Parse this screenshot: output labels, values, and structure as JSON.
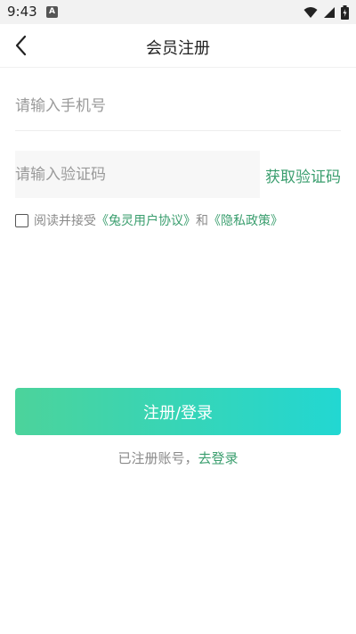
{
  "status_bar": {
    "time": "9:43",
    "notification_badge": "A",
    "icons": [
      "wifi-icon",
      "signal-icon",
      "battery-icon"
    ]
  },
  "header": {
    "title": "会员注册",
    "back_icon": "chevron-left-icon"
  },
  "form": {
    "phone_placeholder": "请输入手机号",
    "phone_value": "",
    "code_placeholder": "请输入验证码",
    "code_value": "",
    "get_code_label": "获取验证码"
  },
  "agreement": {
    "checked": false,
    "prefix": "阅读并接受",
    "user_agreement": "《兔灵用户协议》",
    "conjunction": "和",
    "privacy_policy": "《隐私政策》"
  },
  "actions": {
    "register_label": "注册/登录",
    "login_prompt": "已注册账号，",
    "login_link": "去登录"
  },
  "colors": {
    "accent": "#3a9e6e",
    "button_gradient_start": "#4cd39b",
    "button_gradient_end": "#22d7d2"
  }
}
